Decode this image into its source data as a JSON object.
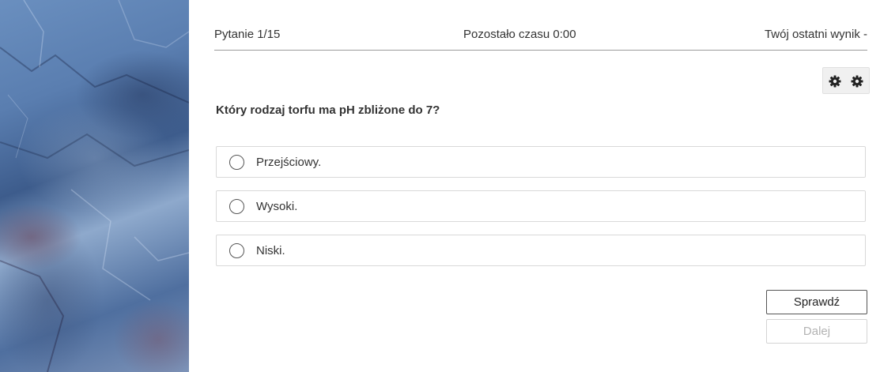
{
  "header": {
    "question_counter": "Pytanie 1/15",
    "time_left": "Pozostało czasu 0:00",
    "last_score": "Twój ostatni wynik -"
  },
  "settings": {
    "icons": [
      "gear-icon",
      "gear-icon"
    ]
  },
  "question": {
    "text": "Który rodzaj torfu ma pH zbliżone do 7?"
  },
  "options": [
    {
      "label": "Przejściowy.",
      "selected": false
    },
    {
      "label": "Wysoki.",
      "selected": false
    },
    {
      "label": "Niski.",
      "selected": false
    }
  ],
  "buttons": {
    "check_label": "Sprawdź",
    "next_label": "Dalej",
    "next_disabled": true
  },
  "colors": {
    "text": "#333333",
    "divider": "#9a9a9a",
    "option_border": "#d9d9d9",
    "disabled_text": "#b3b3b3"
  }
}
